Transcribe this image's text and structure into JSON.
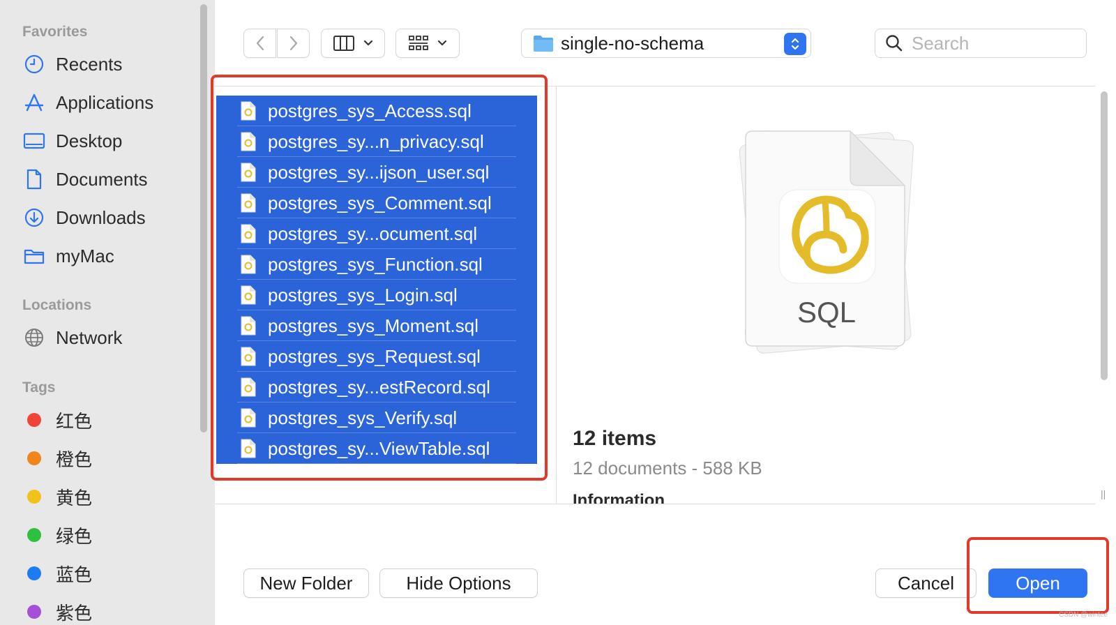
{
  "sidebar": {
    "favorites_title": "Favorites",
    "favorites": [
      {
        "label": "Recents",
        "icon": "clock-icon"
      },
      {
        "label": "Applications",
        "icon": "applications-icon"
      },
      {
        "label": "Desktop",
        "icon": "desktop-icon"
      },
      {
        "label": "Documents",
        "icon": "document-icon"
      },
      {
        "label": "Downloads",
        "icon": "download-icon"
      },
      {
        "label": "myMac",
        "icon": "folder-icon"
      }
    ],
    "locations_title": "Locations",
    "locations": [
      {
        "label": "Network",
        "icon": "globe-icon"
      }
    ],
    "tags_title": "Tags",
    "tags": [
      {
        "label": "红色",
        "color": "#f0443a"
      },
      {
        "label": "橙色",
        "color": "#f0851e"
      },
      {
        "label": "黄色",
        "color": "#f3c21a"
      },
      {
        "label": "绿色",
        "color": "#2fbf41"
      },
      {
        "label": "蓝色",
        "color": "#1b7cf3"
      },
      {
        "label": "紫色",
        "color": "#a550d6"
      }
    ]
  },
  "toolbar": {
    "path": "single-no-schema",
    "search_placeholder": "Search"
  },
  "files": [
    "postgres_sys_Access.sql",
    "postgres_sy...n_privacy.sql",
    "postgres_sy...ijson_user.sql",
    "postgres_sys_Comment.sql",
    "postgres_sy...ocument.sql",
    "postgres_sys_Function.sql",
    "postgres_sys_Login.sql",
    "postgres_sys_Moment.sql",
    "postgres_sys_Request.sql",
    "postgres_sy...estRecord.sql",
    "postgres_sys_Verify.sql",
    "postgres_sy...ViewTable.sql"
  ],
  "preview": {
    "file_type_label": "SQL",
    "items_count": "12 items",
    "items_desc": "12 documents - 588 KB",
    "info_label": "Information"
  },
  "buttons": {
    "new_folder": "New Folder",
    "hide_options": "Hide Options",
    "cancel": "Cancel",
    "open": "Open"
  },
  "colors": {
    "selection": "#2b63d9",
    "accent": "#2f74f0",
    "annotation": "#e23a2a"
  },
  "watermark": "CSDN @wintee"
}
